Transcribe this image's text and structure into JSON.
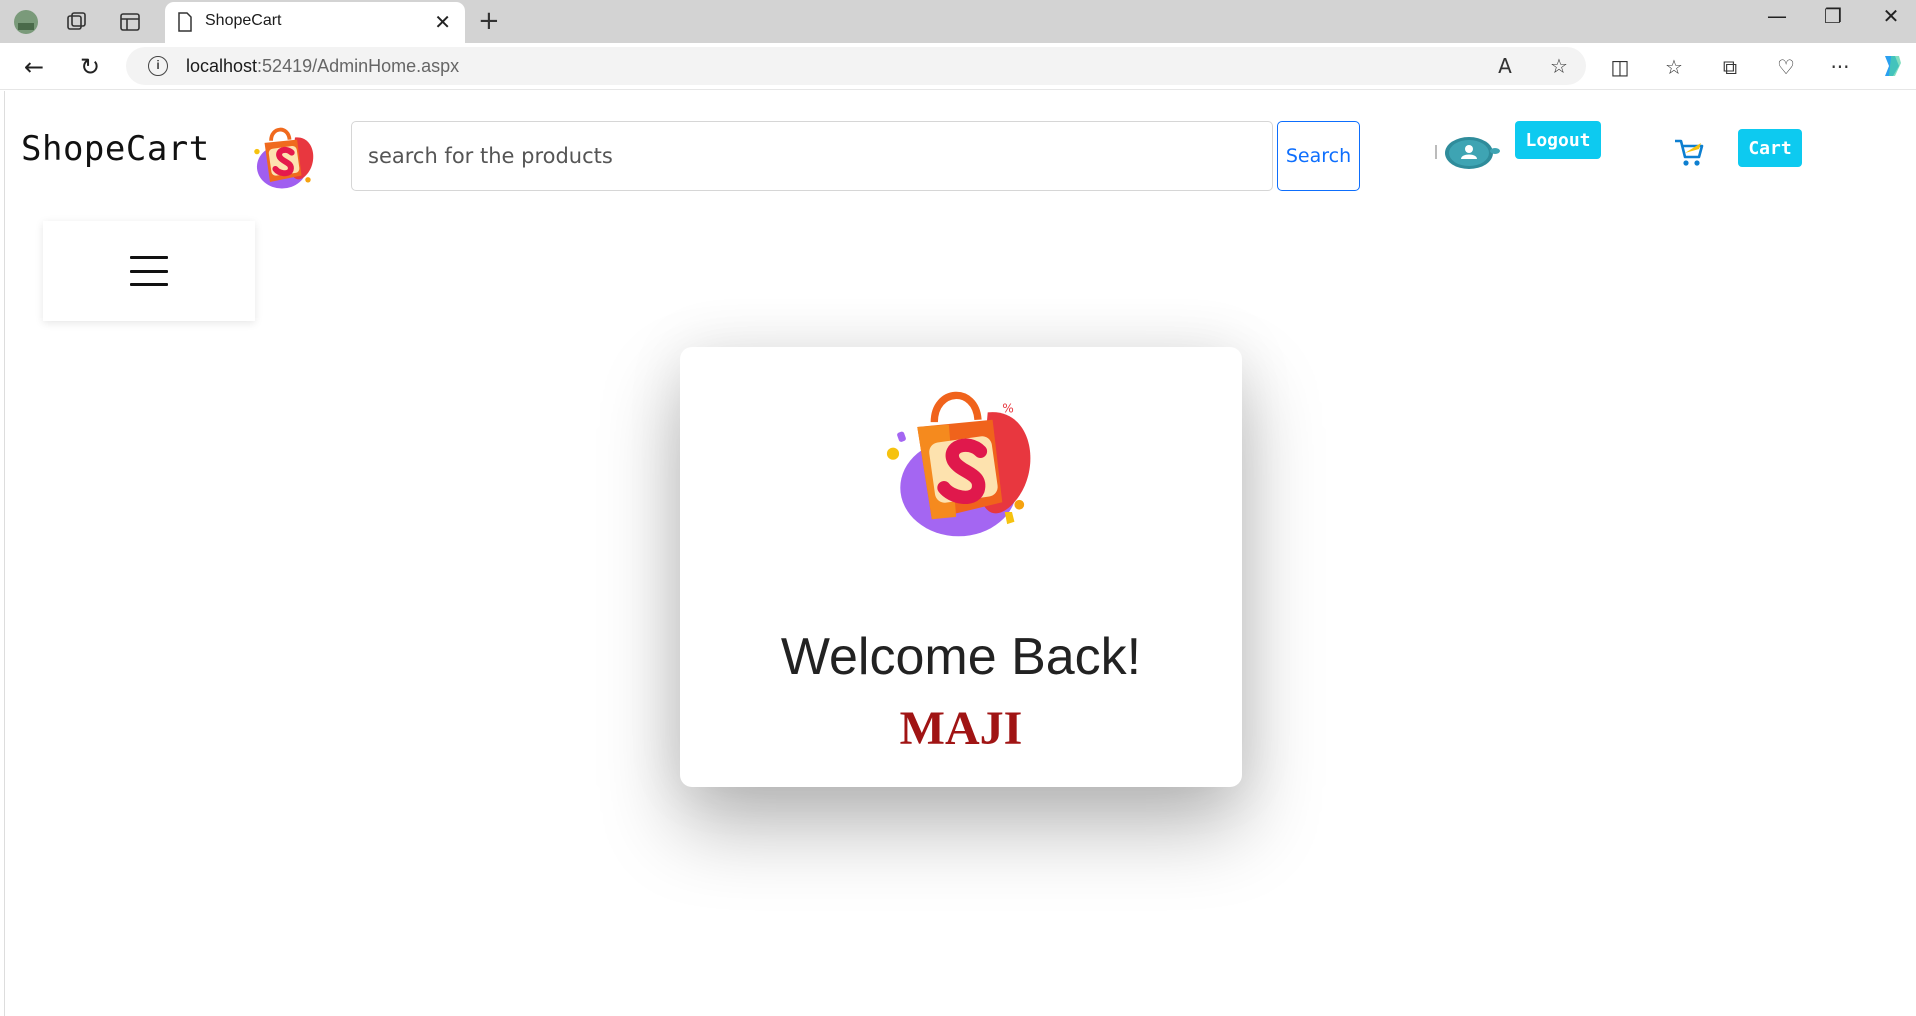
{
  "browser": {
    "tab_title": "ShopeCart",
    "url_host": "localhost",
    "url_path": ":52419/AdminHome.aspx"
  },
  "header": {
    "brand": "ShopeCart",
    "search_placeholder": "search for the products",
    "search_button": "Search",
    "logout_button": "Logout",
    "cart_button": "Cart"
  },
  "welcome": {
    "heading": "Welcome Back!",
    "username": "MAJI"
  },
  "colors": {
    "accent": "#0dcaf0",
    "primary": "#0d6efd",
    "username": "#a01414"
  }
}
